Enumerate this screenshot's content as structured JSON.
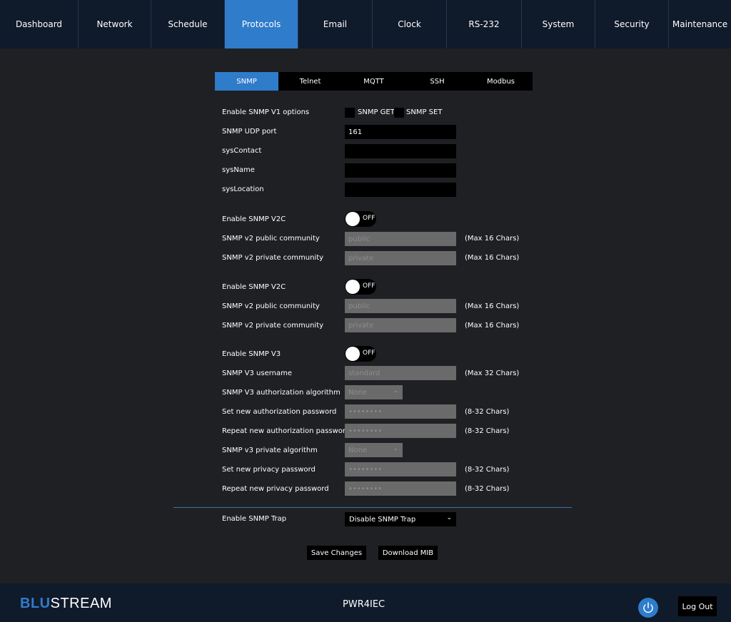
{
  "nav": {
    "tabs": [
      "Dashboard",
      "Network",
      "Schedule",
      "Protocols",
      "Email",
      "Clock",
      "RS-232",
      "System",
      "Security",
      "Maintenance"
    ],
    "active": "Protocols"
  },
  "subtabs": [
    "SNMP",
    "Telnet",
    "MQTT",
    "SSH",
    "Modbus"
  ],
  "v1": {
    "enable_label": "Enable SNMP V1 options",
    "get_label": "SNMP GET",
    "set_label": "SNMP SET",
    "udp_label": "SNMP UDP port",
    "udp_value": "161",
    "syscontact_label": "sysContact",
    "sysname_label": "sysName",
    "syslocation_label": "sysLocation"
  },
  "v2c_a": {
    "enable_label": "Enable SNMP V2C",
    "toggle_state": "OFF",
    "public_label": "SNMP v2 public community",
    "public_value": "public",
    "private_label": "SNMP v2 private community",
    "private_value": "private",
    "hint": "(Max 16 Chars)"
  },
  "v2c_b": {
    "enable_label": "Enable SNMP V2C",
    "toggle_state": "OFF",
    "public_label": "SNMP v2 public community",
    "public_value": "public",
    "private_label": "SNMP v2 private community",
    "private_value": "private",
    "hint": "(Max 16 Chars)"
  },
  "v3": {
    "enable_label": "Enable SNMP V3",
    "toggle_state": "OFF",
    "username_label": "SNMP V3 username",
    "username_value": "standard",
    "username_hint": "(Max 32 Chars)",
    "auth_algo_label": "SNMP V3 authorization algorithm",
    "auth_algo_value": "None",
    "set_auth_label": "Set new authorization password",
    "repeat_auth_label": "Repeat new authorization password",
    "priv_algo_label": "SNMP v3 private algorithm",
    "priv_algo_value": "None",
    "set_priv_label": "Set new privacy password",
    "repeat_priv_label": "Repeat new privacy password",
    "password_mask": "••••••••",
    "password_hint": "(8-32 Chars)"
  },
  "trap": {
    "label": "Enable SNMP Trap",
    "value": "Disable SNMP Trap"
  },
  "buttons": {
    "save": "Save Changes",
    "download": "Download MIB"
  },
  "footer": {
    "logo_blu": "BLU",
    "logo_stream": "STREAM",
    "model": "PWR4IEC",
    "logout": "Log Out"
  },
  "colors": {
    "accent": "#2f7ccb",
    "nav_bg": "#0f1a2b",
    "content_bg": "#1f2024"
  }
}
